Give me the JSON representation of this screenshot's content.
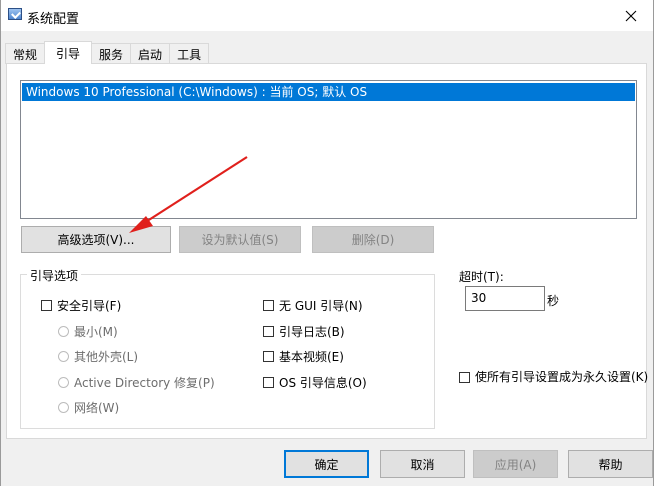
{
  "window": {
    "title": "系统配置",
    "icon": "msconfig-icon"
  },
  "tabs": [
    {
      "label": "常规",
      "active": false
    },
    {
      "label": "引导",
      "active": true
    },
    {
      "label": "服务",
      "active": false
    },
    {
      "label": "启动",
      "active": false
    },
    {
      "label": "工具",
      "active": false
    }
  ],
  "boot": {
    "os_entries": [
      "Windows 10 Professional (C:\\Windows) : 当前 OS; 默认 OS"
    ],
    "buttons": {
      "advanced": "高级选项(V)...",
      "set_default": "设为默认值(S)",
      "delete": "删除(D)"
    },
    "options_group": {
      "legend": "引导选项",
      "safe_boot": "安全引导(F)",
      "safe_boot_options": [
        "最小(M)",
        "其他外壳(L)",
        "Active Directory 修复(P)",
        "网络(W)"
      ],
      "right_options": [
        "无 GUI 引导(N)",
        "引导日志(B)",
        "基本视频(E)",
        "OS 引导信息(O)"
      ]
    },
    "timeout": {
      "label": "超时(T):",
      "value": "30",
      "unit": "秒"
    },
    "permanent": "使所有引导设置成为永久设置(K)"
  },
  "footer": {
    "ok": "确定",
    "cancel": "取消",
    "apply": "应用(A)",
    "help": "帮助"
  },
  "colors": {
    "selection": "#0078d7",
    "annotation_arrow": "#e0201c"
  }
}
